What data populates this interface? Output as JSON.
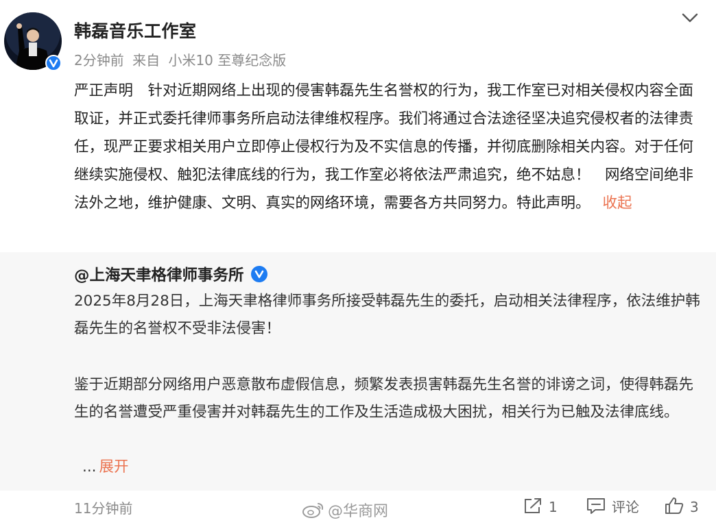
{
  "post": {
    "author": "韩磊音乐工作室",
    "time": "2分钟前",
    "source_prefix": "来自",
    "source_device": "小米10 至尊纪念版",
    "body": "严正声明　针对近期网络上出现的侵害韩磊先生名誉权的行为，我工作室已对相关侵权内容全面取证，并正式委托律师事务所启动法律维权程序。我们将通过合法途径坚决追究侵权者的法律责任，现严正要求相关用户立即停止侵权行为及不实信息的传播，并彻底删除相关内容。对于任何继续实施侵权、触犯法律底线的行为，我工作室必将依法严肃追究，绝不姑息！　网络空间绝非法外之地，维护健康、文明、真实的网络环境，需要各方共同努力。特此声明。",
    "collapse_label": "收起"
  },
  "retweet": {
    "author": "@上海天聿格律师事务所",
    "paragraph1": "2025年8月28日，上海天聿格律师事务所接受韩磊先生的委托，启动相关法律程序，依法维护韩磊先生的名誉权不受非法侵害！",
    "paragraph2": "鉴于近期部分网络用户恶意散布虚假信息，频繁发表损害韩磊先生名誉的诽谤之词，使得韩磊先生的名誉遭受严重侵害并对韩磊先生的工作及生活造成极大困扰，相关行为已触及法律底线。",
    "ellipsis": "...",
    "expand_label": "展开",
    "time": "11分钟前",
    "actions": {
      "share_count": "1",
      "comment_label": "评论",
      "like_count": "3"
    }
  },
  "watermark": "@华商网",
  "icons": {
    "avatar": "avatar-icon",
    "verified": "verified-badge-icon",
    "menu": "chevron-down-icon",
    "share": "share-icon",
    "comment": "comment-icon",
    "like": "thumbs-up-icon",
    "weibo": "weibo-logo-icon"
  },
  "colors": {
    "link": "#eb7350",
    "verified": "#1d7cf2",
    "retweet_bg": "#f7f7f7",
    "meta": "#8a8a8a"
  }
}
